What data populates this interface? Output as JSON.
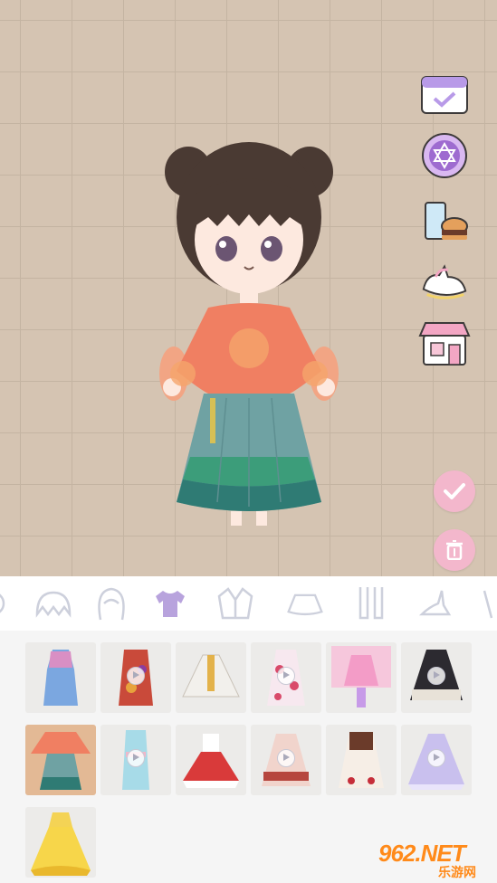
{
  "side_buttons": [
    {
      "name": "calendar-checkin",
      "icon": "calendar-icon"
    },
    {
      "name": "star-of-david-badge",
      "icon": "star-badge-icon"
    },
    {
      "name": "food-drink",
      "icon": "drink-burger-icon"
    },
    {
      "name": "unicorn-ride",
      "icon": "unicorn-icon"
    },
    {
      "name": "shop",
      "icon": "shop-icon"
    }
  ],
  "actions": {
    "confirm_icon": "check-icon",
    "delete_icon": "trash-icon"
  },
  "category_tabs": [
    {
      "name": "partial",
      "icon": "partial-icon"
    },
    {
      "name": "bangs",
      "icon": "bangs-icon"
    },
    {
      "name": "hair",
      "icon": "hair-icon"
    },
    {
      "name": "tops",
      "icon": "tshirt-icon",
      "active": true
    },
    {
      "name": "jackets",
      "icon": "jacket-icon"
    },
    {
      "name": "skirts",
      "icon": "skirt-icon"
    },
    {
      "name": "socks",
      "icon": "socks-icon"
    },
    {
      "name": "shoes",
      "icon": "heel-icon"
    },
    {
      "name": "more",
      "icon": "partial-icon"
    }
  ],
  "items": [
    {
      "name": "hanfu-pink-blue",
      "video": false
    },
    {
      "name": "floral-kimono-dress",
      "video": true
    },
    {
      "name": "white-gold-dress",
      "video": false
    },
    {
      "name": "cherry-floral-dress",
      "video": true
    },
    {
      "name": "pink-magical-outfit",
      "video": false
    },
    {
      "name": "black-lolita-dress",
      "video": true
    },
    {
      "name": "orange-green-hanfu",
      "video": false,
      "selected": true
    },
    {
      "name": "blue-kimono",
      "video": true
    },
    {
      "name": "strawberry-red-dress",
      "video": false
    },
    {
      "name": "pink-strawberry-lolita",
      "video": true
    },
    {
      "name": "cherry-lace-dress",
      "video": false
    },
    {
      "name": "lavender-ballgown",
      "video": true
    },
    {
      "name": "yellow-princess-gown",
      "video": false
    }
  ],
  "colors": {
    "background": "#d5c4b2",
    "grid": "#c4b4a2",
    "accent_pink": "#f3b7cc",
    "tab_active": "#b8a3dd",
    "tab_inactive": "#cdd0dc",
    "selected_item": "#e3b995"
  },
  "watermark": {
    "main": "962.NET",
    "sub": "乐游网"
  }
}
